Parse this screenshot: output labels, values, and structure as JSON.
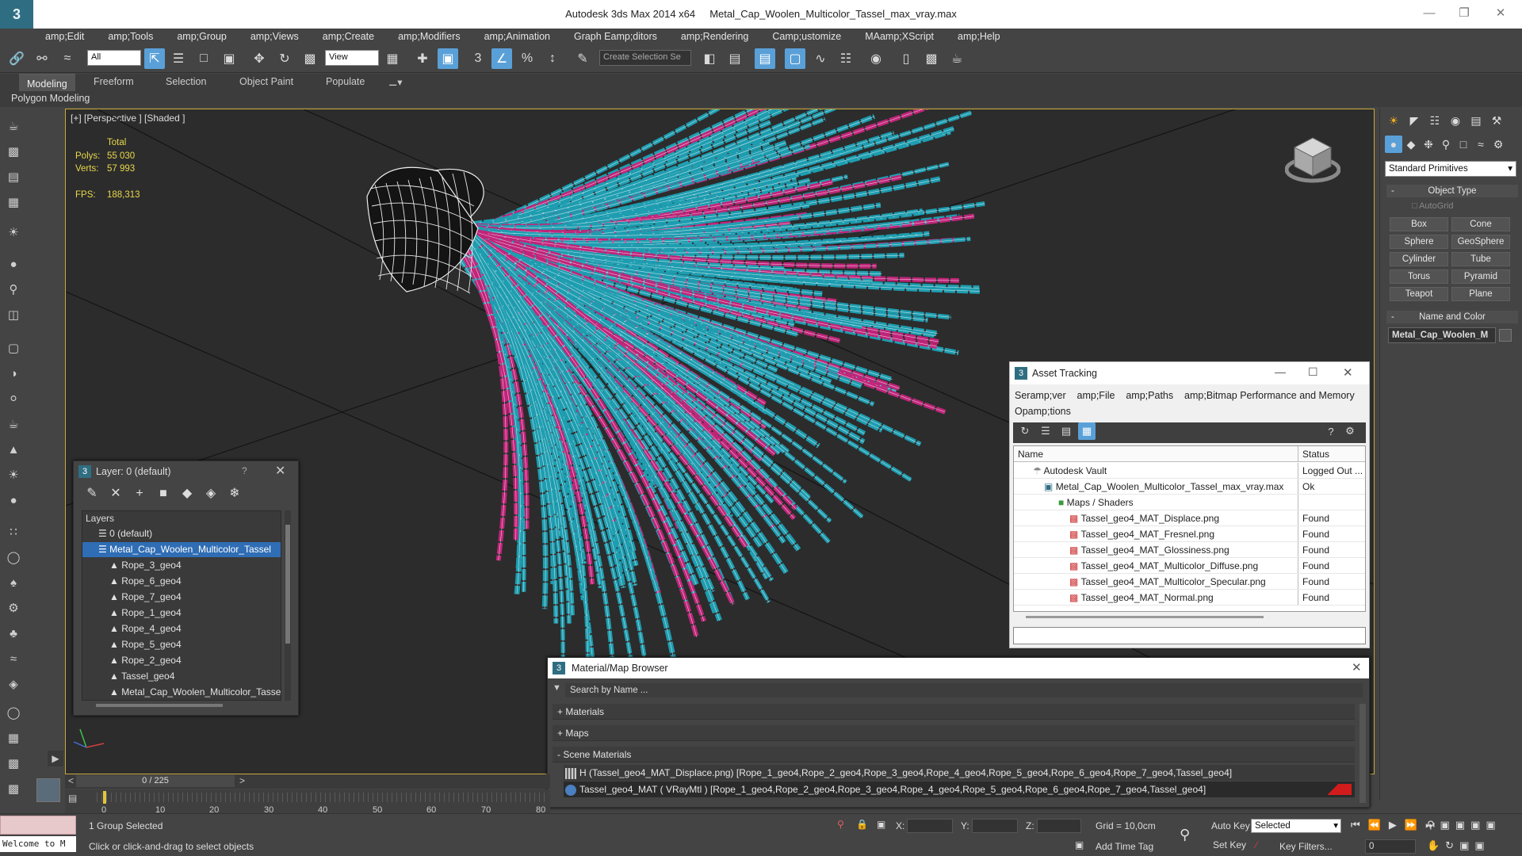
{
  "window": {
    "app_title": "Autodesk 3ds Max  2014 x64",
    "file_title": "Metal_Cap_Woolen_Multicolor_Tassel_max_vray.max",
    "logo_icon": "3dsmax-logo-icon"
  },
  "menu": [
    "amp;Edit",
    "amp;Tools",
    "amp;Group",
    "amp;Views",
    "amp;Create",
    "amp;Modifiers",
    "amp;Animation",
    "Graph Eamp;ditors",
    "amp;Rendering",
    "Camp;ustomize",
    "MAamp;XScript",
    "amp;Help"
  ],
  "toolbar": {
    "selection_filter": "All",
    "ref_coord": "View",
    "named_selection": "Create Selection Se"
  },
  "ribbon": {
    "tabs": [
      "Modeling",
      "Freeform",
      "Selection",
      "Object Paint",
      "Populate"
    ],
    "sub_label": "Polygon Modeling"
  },
  "viewport": {
    "label": "[+] [Perspective ] [Shaded ]",
    "stats": {
      "total_label": "Total",
      "polys_label": "Polys:",
      "polys_value": "55 030",
      "verts_label": "Verts:",
      "verts_value": "57 993",
      "fps_label": "FPS:",
      "fps_value": "188,313"
    },
    "model_colors": {
      "teal": "#1e9db0",
      "magenta": "#c0257a",
      "wire": "#ffffff",
      "cap": "#151515"
    }
  },
  "command_panel": {
    "category": "Standard Primitives",
    "object_type_title": "Object Type",
    "autogrid_label": "AutoGrid",
    "primitives": [
      "Box",
      "Cone",
      "Sphere",
      "GeoSphere",
      "Cylinder",
      "Tube",
      "Torus",
      "Pyramid",
      "Teapot",
      "Plane"
    ],
    "name_color_title": "Name and Color",
    "object_name": "Metal_Cap_Woolen_M"
  },
  "layer_window": {
    "title": "Layer: 0 (default)",
    "help_label": "?",
    "list_header": "Layers",
    "layers": [
      {
        "name": "0 (default)"
      },
      {
        "name": "Metal_Cap_Woolen_Multicolor_Tassel"
      },
      {
        "name": "Rope_3_geo4"
      },
      {
        "name": "Rope_6_geo4"
      },
      {
        "name": "Rope_7_geo4"
      },
      {
        "name": "Rope_1_geo4"
      },
      {
        "name": "Rope_4_geo4"
      },
      {
        "name": "Rope_5_geo4"
      },
      {
        "name": "Rope_2_geo4"
      },
      {
        "name": "Tassel_geo4"
      },
      {
        "name": "Metal_Cap_Woolen_Multicolor_Tassel"
      }
    ]
  },
  "asset_tracking": {
    "title": "Asset Tracking",
    "menu": [
      "Seramp;ver",
      "amp;File",
      "amp;Paths",
      "amp;Bitmap Performance and Memory",
      "Opamp;tions"
    ],
    "col_name": "Name",
    "col_status": "Status",
    "rows": [
      {
        "name": "Autodesk Vault",
        "status": "Logged Out ..."
      },
      {
        "name": "Metal_Cap_Woolen_Multicolor_Tassel_max_vray.max",
        "status": "Ok"
      },
      {
        "name": "Maps / Shaders",
        "status": ""
      },
      {
        "name": "Tassel_geo4_MAT_Displace.png",
        "status": "Found"
      },
      {
        "name": "Tassel_geo4_MAT_Fresnel.png",
        "status": "Found"
      },
      {
        "name": "Tassel_geo4_MAT_Glossiness.png",
        "status": "Found"
      },
      {
        "name": "Tassel_geo4_MAT_Multicolor_Diffuse.png",
        "status": "Found"
      },
      {
        "name": "Tassel_geo4_MAT_Multicolor_Specular.png",
        "status": "Found"
      },
      {
        "name": "Tassel_geo4_MAT_Normal.png",
        "status": "Found"
      }
    ]
  },
  "material_browser": {
    "title": "Material/Map Browser",
    "search_placeholder": "Search by Name ...",
    "sections": [
      "+ Materials",
      "+ Maps",
      "- Scene Materials"
    ],
    "scene_items": [
      "H (Tassel_geo4_MAT_Displace.png) [Rope_1_geo4,Rope_2_geo4,Rope_3_geo4,Rope_4_geo4,Rope_5_geo4,Rope_6_geo4,Rope_7_geo4,Tassel_geo4]",
      "Tassel_geo4_MAT ( VRayMtl ) [Rope_1_geo4,Rope_2_geo4,Rope_3_geo4,Rope_4_geo4,Rope_5_geo4,Rope_6_geo4,Rope_7_geo4,Tassel_geo4]"
    ]
  },
  "timeline": {
    "frame_readout": "0 / 225",
    "ticks": [
      "0",
      "10",
      "20",
      "30",
      "40",
      "50",
      "60",
      "70",
      "80"
    ]
  },
  "status": {
    "welcome": "Welcome to M",
    "selection": "1 Group Selected",
    "prompt": "Click or click-and-drag to select objects",
    "x_label": "X:",
    "y_label": "Y:",
    "z_label": "Z:",
    "grid": "Grid = 10,0cm",
    "add_time_tag": "Add Time Tag",
    "auto_key": "Auto Key",
    "set_key": "Set Key",
    "key_mode": "Selected",
    "key_filters": "Key Filters...",
    "frame": "0"
  }
}
